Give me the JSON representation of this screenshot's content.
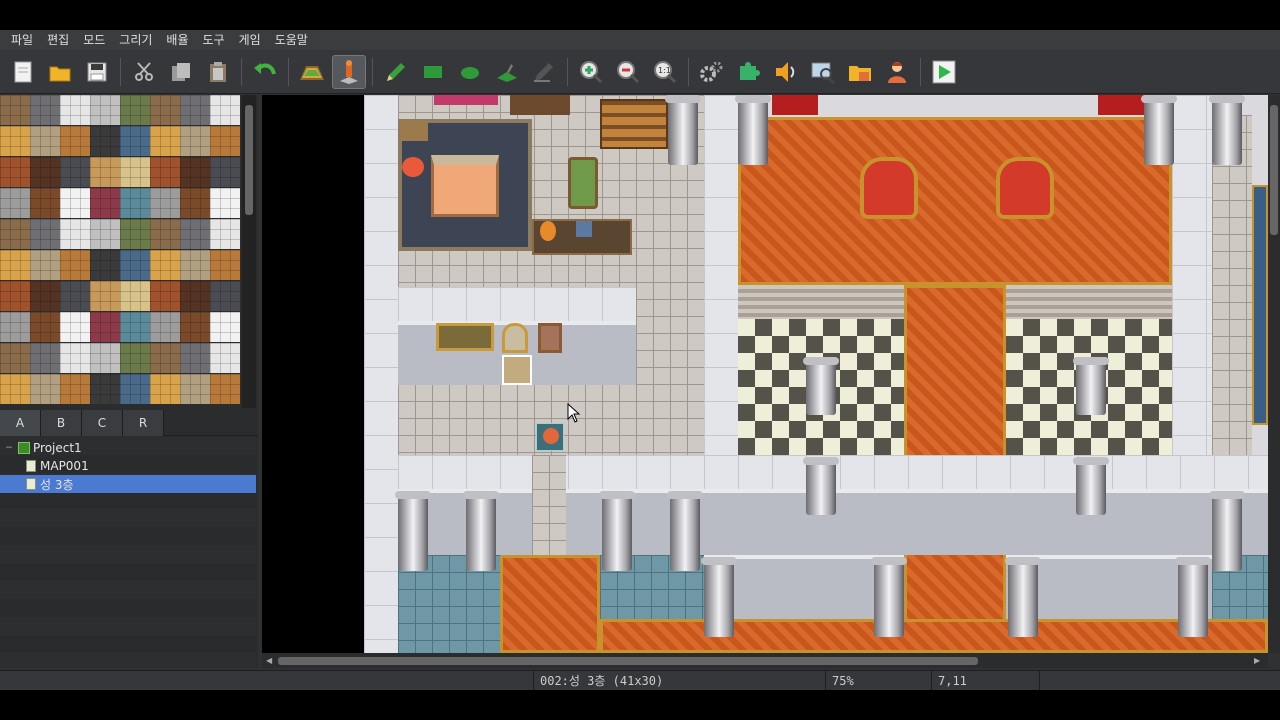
{
  "menu": {
    "items": [
      "파일",
      "편집",
      "모드",
      "그리기",
      "배율",
      "도구",
      "게임",
      "도움말"
    ]
  },
  "toolbar": {
    "buttons": [
      {
        "name": "new-project-icon",
        "color": "#f2f2f2"
      },
      {
        "name": "open-project-icon",
        "color": "#f0b429"
      },
      {
        "name": "save-project-icon",
        "color": "#e6e6e6"
      },
      {
        "name": "cut-icon",
        "color": "#b9b9b9"
      },
      {
        "name": "copy-icon",
        "color": "#b9b9b9"
      },
      {
        "name": "paste-icon",
        "color": "#b9b9b9"
      },
      {
        "name": "undo-icon",
        "color": "#3fb43f"
      },
      {
        "name": "map-mode-icon",
        "color": "#d9a441"
      },
      {
        "name": "event-mode-icon",
        "color": "#e0661d"
      },
      {
        "name": "pencil-icon",
        "color": "#3aa23a"
      },
      {
        "name": "rectangle-icon",
        "color": "#2f9a3a"
      },
      {
        "name": "ellipse-icon",
        "color": "#2f9a3a"
      },
      {
        "name": "fill-icon",
        "color": "#2f9a3a"
      },
      {
        "name": "shadow-pen-icon",
        "color": "#777777"
      },
      {
        "name": "zoom-in-icon",
        "color": "#2ea85a"
      },
      {
        "name": "zoom-out-icon",
        "color": "#d2373a"
      },
      {
        "name": "zoom-actual-icon",
        "color": "#e8e8e8"
      },
      {
        "name": "database-icon",
        "color": "#bcbcbc"
      },
      {
        "name": "plugin-manager-icon",
        "color": "#38b26a"
      },
      {
        "name": "sound-test-icon",
        "color": "#f0a020"
      },
      {
        "name": "event-searcher-icon",
        "color": "#bcd6ea"
      },
      {
        "name": "resource-manager-icon",
        "color": "#f0b429"
      },
      {
        "name": "character-generator-icon",
        "color": "#e46d3a"
      },
      {
        "name": "playtest-icon",
        "color": "#2fb84a"
      }
    ]
  },
  "tabs": [
    "A",
    "B",
    "C",
    "R"
  ],
  "tree": {
    "project": "Project1",
    "maps": [
      "MAP001",
      "성 3층"
    ],
    "selected_index": 1
  },
  "status": {
    "map_info": "002:성 3층 (41x30)",
    "zoom": "75%",
    "coords": "7,11"
  },
  "colors": {
    "selection": "#4a7bd1",
    "background": "#2f3133"
  }
}
